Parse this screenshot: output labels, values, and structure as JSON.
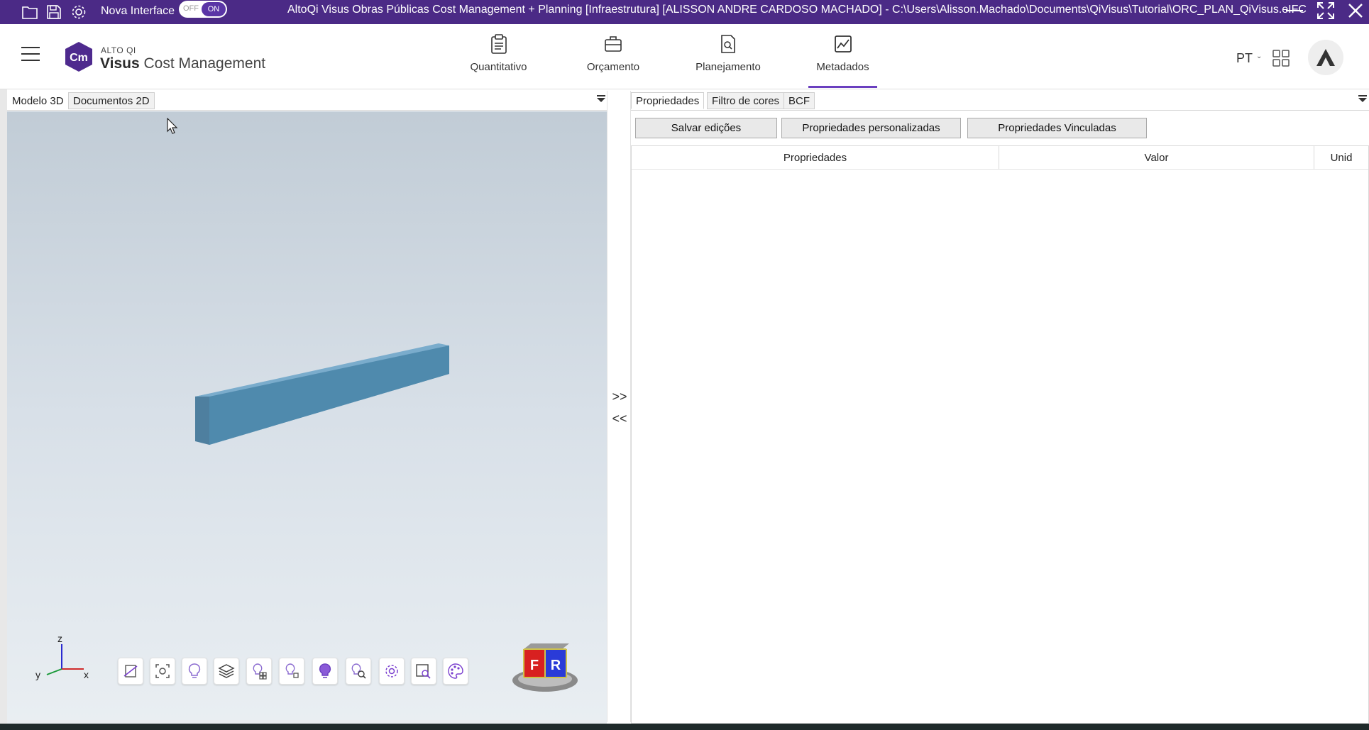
{
  "titlebar": {
    "nova_interface_label": "Nova Interface",
    "toggle_off": "OFF",
    "toggle_on": "ON",
    "window_title": "AltoQi Visus Obras Públicas Cost Management + Planning [Infraestrutura] [ALISSON ANDRE CARDOSO MACHADO] - C:\\Users\\Alisson.Machado\\Documents\\QiVisus\\Tutorial\\ORC_PLAN_QiVisus.eIFC",
    "accent_color": "#4b2a86"
  },
  "header": {
    "logo_badge": "Cm",
    "logo_sub": "ALTO QI",
    "logo_brand": "Visus",
    "logo_product": "Cost Management",
    "nav": [
      {
        "label": "Quantitativo",
        "icon": "clipboard-icon"
      },
      {
        "label": "Orçamento",
        "icon": "briefcase-icon"
      },
      {
        "label": "Planejamento",
        "icon": "document-search-icon"
      },
      {
        "label": "Metadados",
        "icon": "chart-icon",
        "active": true
      }
    ],
    "language": "PT"
  },
  "left_pane": {
    "tabs": [
      {
        "label": "Modelo 3D",
        "active": true
      },
      {
        "label": "Documentos 2D",
        "active": false
      }
    ],
    "axes": {
      "z": "z",
      "y": "y",
      "x": "x"
    },
    "viewcube": {
      "front": "F",
      "right": "R"
    },
    "tools": [
      "cut-plane-icon",
      "snapshot-icon",
      "bulb-icon",
      "layers-icon",
      "isolate-icon",
      "hide-icon",
      "light-icon",
      "inspect-icon",
      "settings-icon",
      "zoom-area-icon",
      "palette-icon"
    ]
  },
  "splitter": {
    "expand": ">>",
    "collapse": "<<"
  },
  "right_pane": {
    "tabs": [
      {
        "label": "Propriedades",
        "active": true
      },
      {
        "label": "Filtro de cores",
        "active": false
      },
      {
        "label": "BCF",
        "active": false
      }
    ],
    "buttons": {
      "save": "Salvar edições",
      "custom": "Propriedades personalizadas",
      "linked": "Propriedades Vinculadas"
    },
    "table": {
      "columns": [
        "Propriedades",
        "Valor",
        "Unid"
      ]
    }
  }
}
